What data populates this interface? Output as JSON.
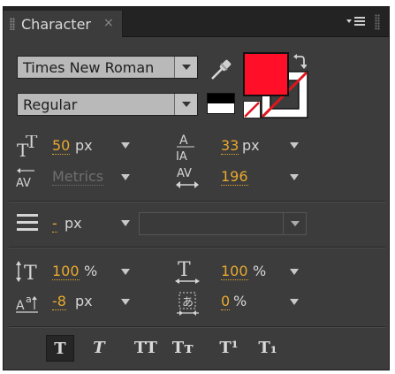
{
  "panel": {
    "title": "Character",
    "close_glyph": "×"
  },
  "font": {
    "family": "Times New Roman",
    "style": "Regular"
  },
  "fill_color": "#ff0f28",
  "stroke_color": "none",
  "size": {
    "value": "50",
    "unit": "px"
  },
  "leading": {
    "value": "33",
    "unit": "px"
  },
  "kerning": {
    "value": "Metrics"
  },
  "tracking": {
    "value": "196"
  },
  "stroke_width": {
    "value": "-",
    "unit": "px",
    "type": ""
  },
  "vertical_scale": {
    "value": "100",
    "unit": "%"
  },
  "horizontal_scale": {
    "value": "100",
    "unit": "%"
  },
  "baseline_shift": {
    "value": "-8",
    "unit": "px"
  },
  "tsume": {
    "value": "0",
    "unit": "%"
  },
  "format_buttons": [
    {
      "label": "T",
      "name": "faux-bold"
    },
    {
      "label": "T",
      "name": "faux-italic"
    },
    {
      "label": "TT",
      "name": "all-caps"
    },
    {
      "label": "Tт",
      "name": "small-caps"
    },
    {
      "label": "T¹",
      "name": "superscript"
    },
    {
      "label": "T₁",
      "name": "subscript"
    }
  ]
}
